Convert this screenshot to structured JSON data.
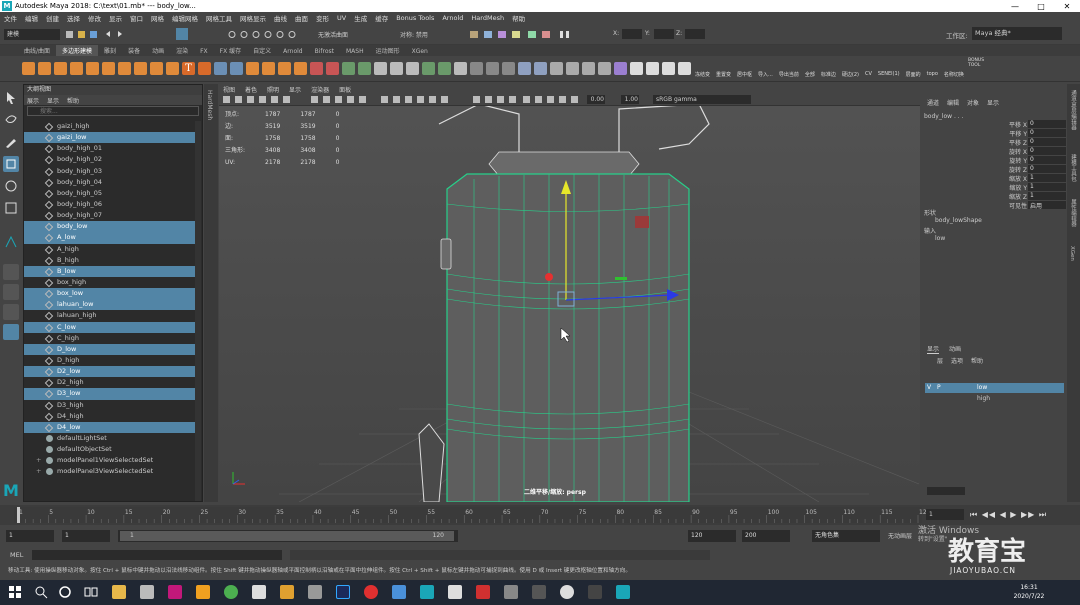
{
  "title_bar": {
    "logo": "M",
    "title": "Autodesk Maya 2018: C:\\text\\01.mb*   ---   body_low...",
    "buttons": [
      "—",
      "□",
      "✕"
    ]
  },
  "menu": [
    "文件",
    "编辑",
    "创建",
    "选择",
    "修改",
    "显示",
    "窗口",
    "网格",
    "编辑网格",
    "网格工具",
    "网格显示",
    "曲线",
    "曲面",
    "变形",
    "UV",
    "生成",
    "缓存",
    "Bonus Tools",
    "Arnold",
    "HardMesh",
    "帮助"
  ],
  "status_line": {
    "mode": "建模",
    "live_surface": "无激活曲面",
    "symmetry": "对称: 禁用",
    "x_label": "X:",
    "y_label": "Y:",
    "z_label": "Z:",
    "workspace_label": "工作区:",
    "workspace": "Maya 经典*"
  },
  "shelf_tabs": [
    "曲线/曲面",
    "多边形建模",
    "雕刻",
    "装备",
    "动画",
    "渲染",
    "FX",
    "FX 缓存",
    "自定义",
    "Arnold",
    "Bifrost",
    "MASH",
    "运动图形",
    "XGen"
  ],
  "shelf_active_tab": "多边形建模",
  "shelf_labels": [
    "冻结变",
    "重置变",
    "居中枢",
    "全部",
    "标准边",
    "硬边(2)",
    "CV",
    "BONUS TOOL",
    "SENEl(1)",
    "层面的",
    "topo",
    "名称切换",
    "导入...",
    "导出当前"
  ],
  "outliner": {
    "title": "大纲视图",
    "menus": [
      "展示",
      "显示",
      "帮助"
    ],
    "search_placeholder": "搜索...",
    "items": [
      {
        "label": "gaizi_high",
        "sel": false,
        "kind": "node"
      },
      {
        "label": "gaizi_low",
        "sel": true,
        "kind": "node"
      },
      {
        "label": "body_high_01",
        "sel": false,
        "kind": "node"
      },
      {
        "label": "body_high_02",
        "sel": false,
        "kind": "node"
      },
      {
        "label": "body_high_03",
        "sel": false,
        "kind": "node"
      },
      {
        "label": "body_high_04",
        "sel": false,
        "kind": "node"
      },
      {
        "label": "body_high_05",
        "sel": false,
        "kind": "node"
      },
      {
        "label": "body_high_06",
        "sel": false,
        "kind": "node"
      },
      {
        "label": "body_high_07",
        "sel": false,
        "kind": "node"
      },
      {
        "label": "body_low",
        "sel": true,
        "kind": "node"
      },
      {
        "label": "A_low",
        "sel": true,
        "kind": "node"
      },
      {
        "label": "A_high",
        "sel": false,
        "kind": "node"
      },
      {
        "label": "B_high",
        "sel": false,
        "kind": "node"
      },
      {
        "label": "B_low",
        "sel": true,
        "kind": "node"
      },
      {
        "label": "box_high",
        "sel": false,
        "kind": "node"
      },
      {
        "label": "box_low",
        "sel": true,
        "kind": "node"
      },
      {
        "label": "lahuan_low",
        "sel": true,
        "kind": "node"
      },
      {
        "label": "lahuan_high",
        "sel": false,
        "kind": "node"
      },
      {
        "label": "C_low",
        "sel": true,
        "kind": "node"
      },
      {
        "label": "C_high",
        "sel": false,
        "kind": "node"
      },
      {
        "label": "D_low",
        "sel": true,
        "kind": "node"
      },
      {
        "label": "D_high",
        "sel": false,
        "kind": "node"
      },
      {
        "label": "D2_low",
        "sel": true,
        "kind": "node"
      },
      {
        "label": "D2_high",
        "sel": false,
        "kind": "node"
      },
      {
        "label": "D3_low",
        "sel": true,
        "kind": "node"
      },
      {
        "label": "D3_high",
        "sel": false,
        "kind": "node"
      },
      {
        "label": "D4_high",
        "sel": false,
        "kind": "node"
      },
      {
        "label": "D4_low",
        "sel": true,
        "kind": "node"
      },
      {
        "label": "defaultLightSet",
        "sel": false,
        "kind": "set"
      },
      {
        "label": "defaultObjectSet",
        "sel": false,
        "kind": "set"
      },
      {
        "label": "modelPanel1ViewSelectedSet",
        "sel": false,
        "kind": "setplus"
      },
      {
        "label": "modelPanel3ViewSelectedSet",
        "sel": false,
        "kind": "setplus"
      }
    ]
  },
  "hardmesh_label": "HardMesh",
  "viewport": {
    "menus": [
      "视图",
      "着色",
      "照明",
      "显示",
      "渲染器",
      "面板"
    ],
    "exposure": "0.00",
    "gamma": "1.00",
    "colorspace": "sRGB gamma",
    "hud": [
      {
        "name": "顶点:",
        "a": "1787",
        "b": "1787",
        "c": "0"
      },
      {
        "name": "边:",
        "a": "3519",
        "b": "3519",
        "c": "0"
      },
      {
        "name": "面:",
        "a": "1758",
        "b": "1758",
        "c": "0"
      },
      {
        "name": "三角形:",
        "a": "3408",
        "b": "3408",
        "c": "0"
      },
      {
        "name": "UV:",
        "a": "2178",
        "b": "2178",
        "c": "0"
      }
    ],
    "camera_label": "二维平移/缩放:  persp"
  },
  "channel_box": {
    "tabs": [
      "通道",
      "编辑",
      "对象",
      "显示"
    ],
    "object": "body_low . . .",
    "attrs": [
      {
        "n": "平移 X",
        "v": "0"
      },
      {
        "n": "平移 Y",
        "v": "0"
      },
      {
        "n": "平移 Z",
        "v": "0"
      },
      {
        "n": "旋转 X",
        "v": "0"
      },
      {
        "n": "旋转 Y",
        "v": "0"
      },
      {
        "n": "旋转 Z",
        "v": "0"
      },
      {
        "n": "缩放 X",
        "v": "1"
      },
      {
        "n": "缩放 Y",
        "v": "1"
      },
      {
        "n": "缩放 Z",
        "v": "1"
      },
      {
        "n": "可见性",
        "v": "启用"
      }
    ],
    "shapes_header": "形状",
    "shape_name": "body_lowShape",
    "inputs_header": "输入",
    "input_name": "low"
  },
  "layer_editor": {
    "tabs": [
      "显示",
      "动画"
    ],
    "menus": [
      "层",
      "选项",
      "帮助"
    ],
    "layers": [
      {
        "v": "V",
        "p": "P",
        "name": "low",
        "sel": true
      },
      {
        "v": "",
        "p": "",
        "name": "high",
        "sel": false
      }
    ]
  },
  "right_strip": [
    "通道盒/层编辑器",
    "建模工具包",
    "属性编辑器",
    "XGen"
  ],
  "timeline": {
    "ticks": [
      "1",
      "5",
      "10",
      "15",
      "20",
      "25",
      "30",
      "35",
      "40",
      "45",
      "50",
      "55",
      "60",
      "65",
      "70",
      "75",
      "80",
      "85",
      "90",
      "95",
      "100",
      "105",
      "110",
      "115",
      "120"
    ],
    "current": "1"
  },
  "range": {
    "start": "1",
    "start_inner": "1",
    "slider_start": "1",
    "slider_end": "120",
    "end_inner": "120",
    "end": "200",
    "character_set": "无角色集",
    "anim_layer": "无动画层"
  },
  "mel": {
    "label": "MEL"
  },
  "help_line": "移动工具: 使用操纵器移动对象。按住 Ctrl + 鼠标中键并拖动以沿法线移动组件。按住 Shift 键并拖动操纵器轴或平面控制柄以沿轴或在平面中拉伸组件。按住 Ctrl + Shift + 鼠标左键并拖动可捕捉到曲线。使用 D 或 Insert 键更改枢轴位置和轴方向。",
  "activate_windows": "激活 Windows",
  "activate_windows_sub": "转到\"设置\"",
  "watermark": {
    "logo": "教育宝",
    "url": "JIAOYUBAO.CN"
  },
  "taskbar": {
    "time": "16:31",
    "date": "2020/7/22"
  }
}
